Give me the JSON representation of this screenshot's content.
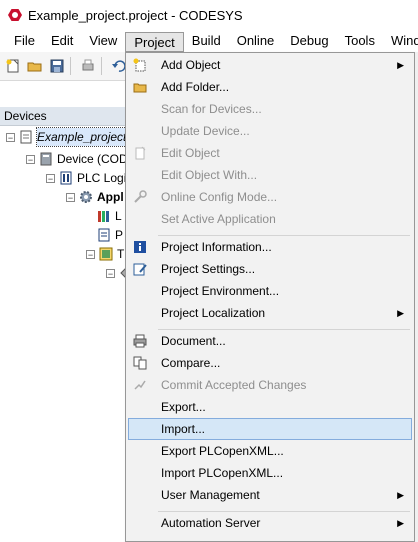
{
  "window": {
    "title": "Example_project.project - CODESYS"
  },
  "menubar": [
    "File",
    "Edit",
    "View",
    "Project",
    "Build",
    "Online",
    "Debug",
    "Tools",
    "Wind"
  ],
  "devices_panel": {
    "header": "Devices",
    "tree": [
      {
        "label": "Example_project",
        "expander": "−"
      },
      {
        "label": "Device (CODE",
        "expander": "−"
      },
      {
        "label": "PLC Logic",
        "expander": "−"
      },
      {
        "label": "Appl",
        "expander": "−"
      },
      {
        "label": "L"
      },
      {
        "label": "P"
      },
      {
        "label": "T",
        "expander": "−"
      },
      {
        "label": "",
        "expander": "−"
      }
    ]
  },
  "project_menu": {
    "items": [
      {
        "label": "Add Object",
        "icon": "add-object-icon",
        "submenu": true
      },
      {
        "label": "Add Folder...",
        "icon": "folder-icon"
      },
      {
        "label": "Scan for Devices...",
        "disabled": true
      },
      {
        "label": "Update Device...",
        "disabled": true
      },
      {
        "label": "Edit Object",
        "icon": "edit-object-icon",
        "disabled": true
      },
      {
        "label": "Edit Object With...",
        "disabled": true
      },
      {
        "label": "Online Config Mode...",
        "icon": "tools-icon",
        "disabled": true
      },
      {
        "label": "Set Active Application",
        "disabled": true
      },
      {
        "separator": true
      },
      {
        "label": "Project Information...",
        "icon": "info-icon"
      },
      {
        "label": "Project Settings...",
        "icon": "settings-icon"
      },
      {
        "label": "Project Environment..."
      },
      {
        "label": "Project Localization",
        "submenu": true
      },
      {
        "separator": true
      },
      {
        "label": "Document...",
        "icon": "printer-icon"
      },
      {
        "label": "Compare...",
        "icon": "compare-icon"
      },
      {
        "label": "Commit Accepted Changes",
        "icon": "commit-icon",
        "disabled": true
      },
      {
        "label": "Export..."
      },
      {
        "label": "Import...",
        "hover": true
      },
      {
        "label": "Export PLCopenXML..."
      },
      {
        "label": "Import PLCopenXML..."
      },
      {
        "label": "User Management",
        "submenu": true
      },
      {
        "separator": true
      },
      {
        "label": "Automation Server",
        "submenu": true
      }
    ]
  },
  "colors": {
    "hover_bg": "#d5e7f7",
    "hover_border": "#84acdd",
    "disabled_text": "#8e8e8e",
    "brand_red": "#c8102e"
  }
}
